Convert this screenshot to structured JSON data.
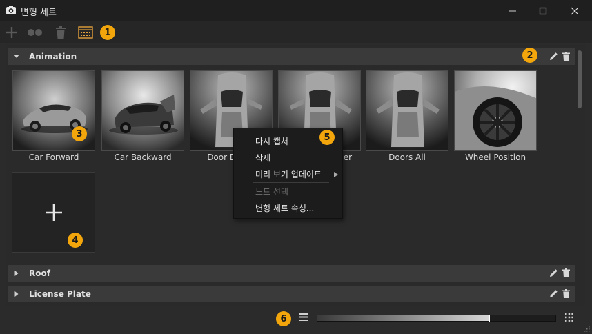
{
  "window": {
    "title": "변형 세트"
  },
  "toolbar": {
    "buttons": [
      {
        "name": "add",
        "icon": "plus-icon"
      },
      {
        "name": "duplicate",
        "icon": "circles-icon"
      },
      {
        "name": "delete",
        "icon": "trash-icon"
      },
      {
        "name": "properties",
        "icon": "panel-icon"
      }
    ]
  },
  "badges": {
    "b1": "1",
    "b2": "2",
    "b3": "3",
    "b4": "4",
    "b5": "5",
    "b6": "6"
  },
  "sections": {
    "animation": {
      "label": "Animation"
    },
    "roof": {
      "label": "Roof"
    },
    "license": {
      "label": "License Plate"
    }
  },
  "thumbnails": [
    {
      "label": "Car Forward"
    },
    {
      "label": "Car Backward"
    },
    {
      "label": "Door Driver"
    },
    {
      "label": "Door Passenger"
    },
    {
      "label": "Doors All"
    },
    {
      "label": "Wheel Position"
    }
  ],
  "context_menu": {
    "recapture": "다시 캡처",
    "delete": "삭제",
    "update_preview": "미리 보기 업데이트",
    "select_nodes": "노드 선택",
    "properties": "변형 세트 속성..."
  },
  "footer": {
    "thumbnail_size": 0.72
  },
  "colors": {
    "badge": "#f2a60c",
    "background": "#2b2b2b",
    "header": "#3a3a3a"
  }
}
